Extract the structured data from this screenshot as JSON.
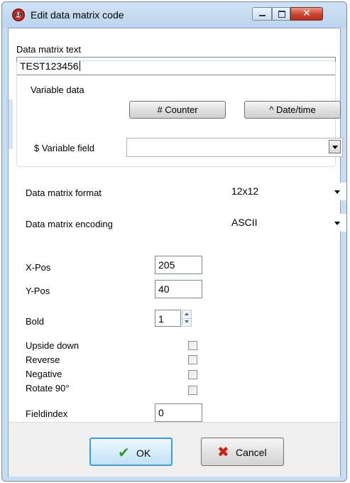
{
  "window": {
    "title": "Edit data matrix code",
    "app_icon": "ab-logo-icon",
    "buttons": [
      "minimize-icon",
      "maximize-icon",
      "close-icon"
    ],
    "close_glyph": "✕"
  },
  "data_matrix_text": {
    "label": "Data matrix text",
    "value": "TEST123456"
  },
  "variable_data": {
    "legend": "Variable data",
    "counter_button": "# Counter",
    "datetime_button": "^ Date/time",
    "variable_field_label": "$ Variable field",
    "variable_field_value": ""
  },
  "format": {
    "label": "Data matrix format",
    "value": "12x12"
  },
  "encoding": {
    "label": "Data matrix encoding",
    "value": "ASCII"
  },
  "position": {
    "x_label": "X-Pos",
    "x_value": "205",
    "y_label": "Y-Pos",
    "y_value": "40"
  },
  "bold": {
    "label": "Bold",
    "value": "1"
  },
  "options": {
    "upside_down": {
      "label": "Upside down",
      "checked": false
    },
    "reverse": {
      "label": "Reverse",
      "checked": false
    },
    "negative": {
      "label": "Negative",
      "checked": false
    },
    "rotate90": {
      "label": "Rotate 90°",
      "checked": false
    }
  },
  "fieldindex": {
    "label": "Fieldindex",
    "value": "0"
  },
  "footer": {
    "ok_label": "OK",
    "ok_icon": "checkmark-icon",
    "ok_glyph": "✔",
    "ok_color": "#2a9a2a",
    "cancel_label": "Cancel",
    "cancel_icon": "red-x-icon",
    "cancel_glyph": "✖",
    "cancel_color": "#d02010"
  }
}
